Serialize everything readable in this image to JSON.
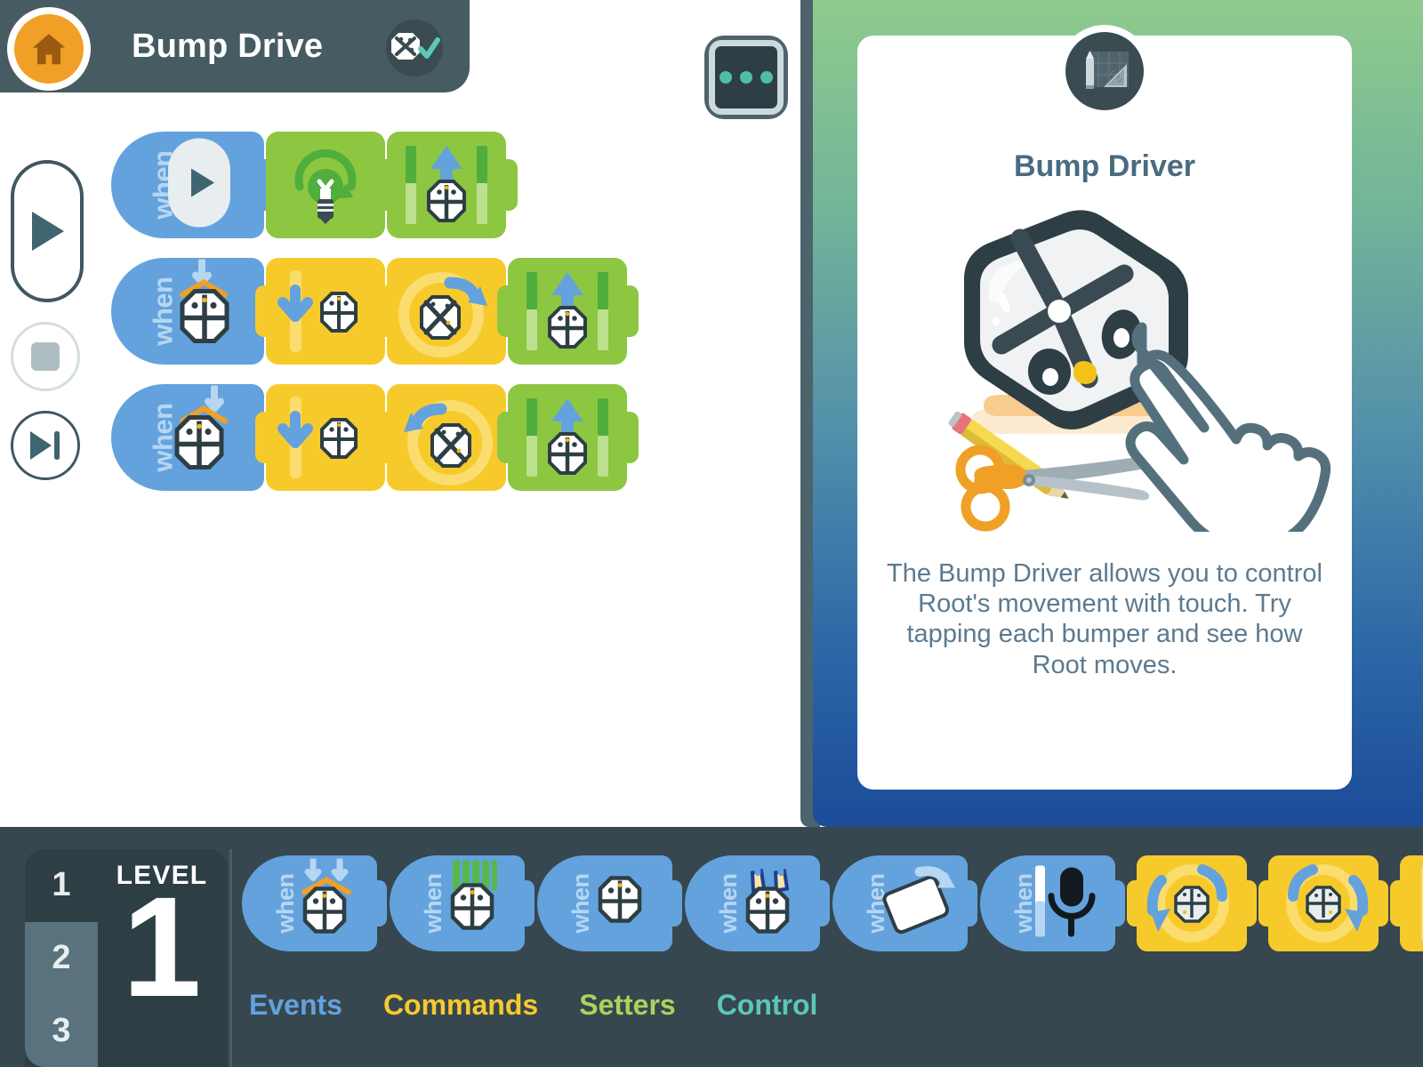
{
  "titlebar": {
    "home_icon": "home-icon",
    "project_title": "Bump Drive",
    "robot_status_icon": "robot-connected-icon",
    "robot_status_check": "checkmark-icon"
  },
  "playback": {
    "play_label": "play-icon",
    "stop_label": "stop-icon",
    "step_label": "step-forward-icon"
  },
  "program": {
    "rows": [
      {
        "blocks": [
          {
            "kind": "when",
            "label": "when",
            "icon": "start-button-event-icon"
          },
          {
            "kind": "setter",
            "icon": "light-color-green-icon"
          },
          {
            "kind": "setter",
            "icon": "drive-forward-icon"
          }
        ]
      },
      {
        "blocks": [
          {
            "kind": "when",
            "label": "when",
            "icon": "bumper-left-pressed-icon"
          },
          {
            "kind": "command",
            "icon": "drive-backward-icon"
          },
          {
            "kind": "command",
            "icon": "turn-right-icon"
          },
          {
            "kind": "setter",
            "icon": "drive-forward-icon"
          }
        ]
      },
      {
        "blocks": [
          {
            "kind": "when",
            "label": "when",
            "icon": "bumper-right-pressed-icon"
          },
          {
            "kind": "command",
            "icon": "drive-backward-icon"
          },
          {
            "kind": "command",
            "icon": "turn-left-icon"
          },
          {
            "kind": "setter",
            "icon": "drive-forward-icon"
          }
        ]
      }
    ]
  },
  "panel": {
    "menu_button_icon": "more-options-icon",
    "card": {
      "badge_icon": "design-tools-icon",
      "title": "Bump Driver",
      "art_icon": "root-robot-tap-illustration",
      "description": "The Bump Driver allows you to control Root's movement with touch. Try tapping each bumper and see how Root moves."
    },
    "gradient_top": "#8fcb8d",
    "gradient_bottom": "#1b4b99"
  },
  "bottombar": {
    "level_word": "LEVEL",
    "level_current": "1",
    "level_tabs": [
      "1",
      "2",
      "3"
    ],
    "palette": [
      {
        "kind": "when",
        "label": "when",
        "icon": "both-bumpers-pressed-icon"
      },
      {
        "kind": "when",
        "label": "when",
        "icon": "color-sensor-event-icon"
      },
      {
        "kind": "when",
        "label": "when",
        "icon": "light-sensor-event-icon"
      },
      {
        "kind": "when",
        "label": "when",
        "icon": "cliff-sensor-event-icon"
      },
      {
        "kind": "when",
        "label": "when",
        "icon": "device-tilt-icon"
      },
      {
        "kind": "when",
        "label": "when",
        "icon": "microphone-sound-icon"
      },
      {
        "kind": "command",
        "icon": "rotate-left-icon"
      },
      {
        "kind": "command",
        "icon": "rotate-right-icon"
      },
      {
        "kind": "command",
        "icon": "drive-forward-command-icon"
      }
    ],
    "categories": [
      {
        "label": "Events",
        "color": "#63a2dd"
      },
      {
        "label": "Commands",
        "color": "#f7ca2c"
      },
      {
        "label": "Setters",
        "color": "#a8d45c"
      },
      {
        "label": "Control",
        "color": "#5cc7b8"
      }
    ]
  }
}
